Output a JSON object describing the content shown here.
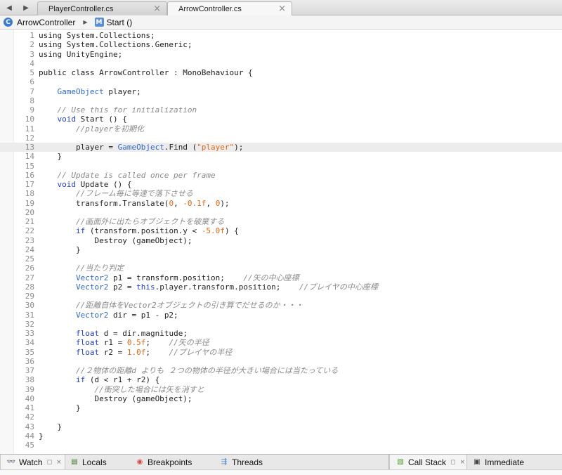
{
  "tabs": [
    {
      "label": "PlayerController.cs",
      "close": "×"
    },
    {
      "label": "ArrowController.cs",
      "close": "×"
    }
  ],
  "nav": {
    "back": "◀",
    "forward": "▶"
  },
  "breadcrumb": {
    "class_icon": "C",
    "class_name": "ArrowController",
    "separator": "▶",
    "method_icon": "M",
    "method_name": "Start ()"
  },
  "editor": {
    "current_line": 13
  },
  "pads": {
    "watch": "Watch",
    "locals": "Locals",
    "breakpoints": "Breakpoints",
    "threads": "Threads",
    "callstack": "Call Stack",
    "immediate": "Immediate",
    "pin": "◻",
    "close": "×"
  },
  "code_lines": [
    [
      [
        "",
        "using System.Collections;"
      ]
    ],
    [
      [
        "",
        "using System.Collections.Generic;"
      ]
    ],
    [
      [
        "",
        "using UnityEngine;"
      ]
    ],
    [],
    [
      [
        "",
        "public class ArrowController : MonoBehaviour {"
      ]
    ],
    [],
    [
      [
        "",
        "    "
      ],
      [
        "t",
        "GameObject"
      ],
      [
        "",
        " player;"
      ]
    ],
    [],
    [
      [
        "c",
        "    // Use this for initialization"
      ]
    ],
    [
      [
        "",
        "    "
      ],
      [
        "k",
        "void"
      ],
      [
        "",
        " Start () {"
      ]
    ],
    [
      [
        "c",
        "        //playerを初期化"
      ]
    ],
    [],
    [
      [
        "",
        "        player = "
      ],
      [
        "t",
        "GameObject"
      ],
      [
        "",
        ".Find ("
      ],
      [
        "s",
        "\"player\""
      ],
      [
        "",
        ");"
      ]
    ],
    [
      [
        "",
        "    }"
      ]
    ],
    [],
    [
      [
        "c",
        "    // Update is called once per frame"
      ]
    ],
    [
      [
        "",
        "    "
      ],
      [
        "k",
        "void"
      ],
      [
        "",
        " Update () {"
      ]
    ],
    [
      [
        "c",
        "        //フレーム毎に等速で落下させる"
      ]
    ],
    [
      [
        "",
        "        transform.Translate("
      ],
      [
        "n",
        "0"
      ],
      [
        "",
        ", "
      ],
      [
        "n",
        "-0.1f"
      ],
      [
        "",
        ", "
      ],
      [
        "n",
        "0"
      ],
      [
        "",
        ");"
      ]
    ],
    [],
    [
      [
        "c",
        "        //画面外に出たらオブジェクトを破棄する"
      ]
    ],
    [
      [
        "",
        "        "
      ],
      [
        "k",
        "if"
      ],
      [
        "",
        " (transform.position.y < "
      ],
      [
        "n",
        "-5.0f"
      ],
      [
        "",
        ") {"
      ]
    ],
    [
      [
        "",
        "            Destroy (gameObject);"
      ]
    ],
    [
      [
        "",
        "        }"
      ]
    ],
    [],
    [
      [
        "c",
        "        //当たり判定"
      ]
    ],
    [
      [
        "",
        "        "
      ],
      [
        "t",
        "Vector2"
      ],
      [
        "",
        " p1 = transform.position;    "
      ],
      [
        "c",
        "//矢の中心座標"
      ]
    ],
    [
      [
        "",
        "        "
      ],
      [
        "t",
        "Vector2"
      ],
      [
        "",
        " p2 = "
      ],
      [
        "k",
        "this"
      ],
      [
        "",
        ".player.transform.position;    "
      ],
      [
        "c",
        "//プレイヤの中心座標"
      ]
    ],
    [],
    [
      [
        "c",
        "        //距離自体をVector2オブジェクトの引き算でだせるのか・・・"
      ]
    ],
    [
      [
        "",
        "        "
      ],
      [
        "t",
        "Vector2"
      ],
      [
        "",
        " dir = p1 - p2;"
      ]
    ],
    [],
    [
      [
        "",
        "        "
      ],
      [
        "k",
        "float"
      ],
      [
        "",
        " d = dir.magnitude;"
      ]
    ],
    [
      [
        "",
        "        "
      ],
      [
        "k",
        "float"
      ],
      [
        "",
        " r1 = "
      ],
      [
        "n",
        "0.5f"
      ],
      [
        "",
        ";    "
      ],
      [
        "c",
        "//矢の半径"
      ]
    ],
    [
      [
        "",
        "        "
      ],
      [
        "k",
        "float"
      ],
      [
        "",
        " r2 = "
      ],
      [
        "n",
        "1.0f"
      ],
      [
        "",
        ";    "
      ],
      [
        "c",
        "//プレイヤの半径"
      ]
    ],
    [],
    [
      [
        "c",
        "        //２物体の距離d よりも ２つの物体の半径が大きい場合には当たっている"
      ]
    ],
    [
      [
        "",
        "        "
      ],
      [
        "k",
        "if"
      ],
      [
        "",
        " (d < r1 + r2) {"
      ]
    ],
    [
      [
        "c",
        "            //衝突した場合には矢を消すと"
      ]
    ],
    [
      [
        "",
        "            Destroy (gameObject);"
      ]
    ],
    [
      [
        "",
        "        }"
      ]
    ],
    [],
    [
      [
        "",
        "    }"
      ]
    ],
    [
      [
        "",
        "}"
      ]
    ],
    []
  ]
}
